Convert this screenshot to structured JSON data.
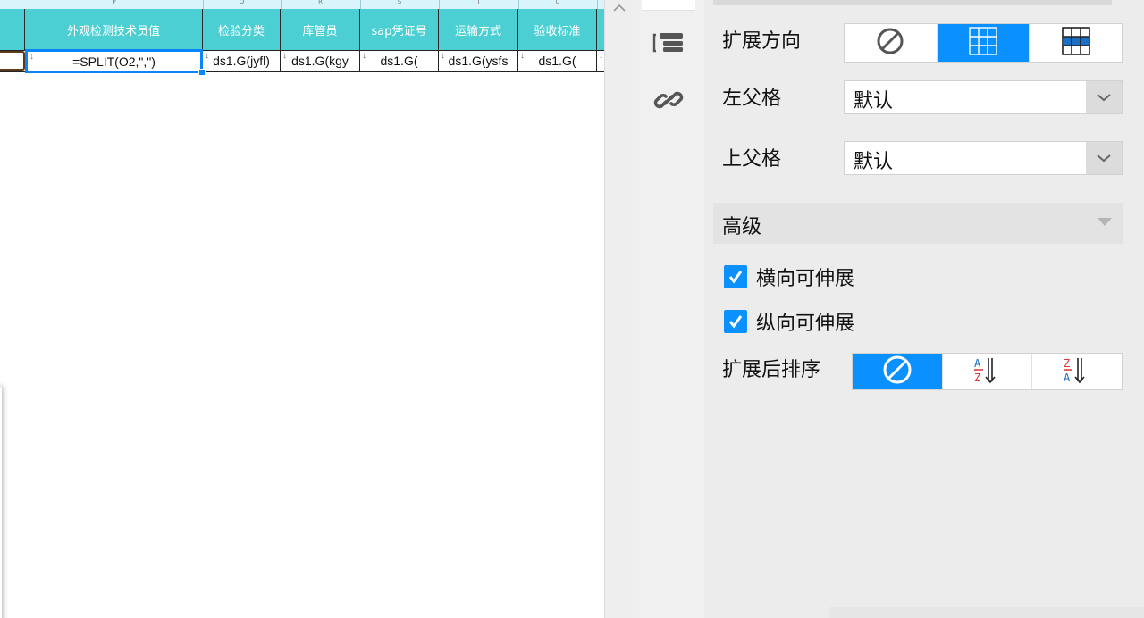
{
  "sheet": {
    "column_letters": [
      "P",
      "Q",
      "R",
      "S",
      "T",
      "U"
    ],
    "headers": [
      "外观检测技术员值",
      "检验分类",
      "库管员",
      "sap凭证号",
      "运输方式",
      "验收标准"
    ],
    "cells": [
      "=SPLIT(O2,\",\")",
      "ds1.G(jyfl)",
      "ds1.G(kgy",
      "ds1.G(",
      "ds1.G(ysfs",
      "ds1.G("
    ],
    "header_color": "#4ccfd3",
    "selection_color": "#0a84ff"
  },
  "tool_strip": {
    "icons": [
      "cell-list-icon",
      "link-icon"
    ]
  },
  "props": {
    "expand_direction": {
      "label": "扩展方向",
      "options": [
        "no-expand-icon",
        "vertical-expand-icon",
        "horizontal-expand-icon"
      ],
      "active_index": 1
    },
    "left_parent": {
      "label": "左父格",
      "value": "默认"
    },
    "top_parent": {
      "label": "上父格",
      "value": "默认"
    },
    "advanced": {
      "title": "高级",
      "horizontal_extensible": {
        "label": "横向可伸展",
        "checked": true
      },
      "vertical_extensible": {
        "label": "纵向可伸展",
        "checked": true
      },
      "sort_after_expand": {
        "label": "扩展后排序",
        "options": [
          "no-sort-icon",
          "sort-ascending-icon",
          "sort-descending-icon"
        ],
        "active_index": 0
      }
    },
    "accent_color": "#0a90ff"
  }
}
